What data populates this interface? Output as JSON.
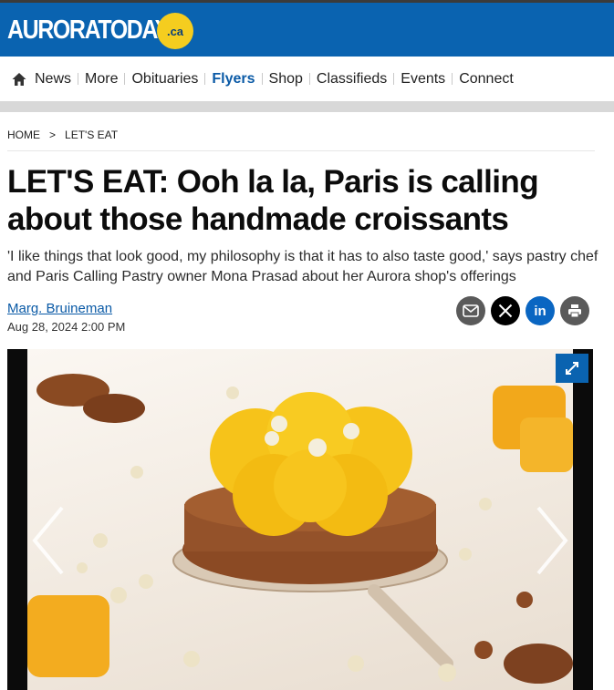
{
  "header": {
    "logo_text": "AURORATODAY",
    "logo_badge": ".ca",
    "brand_color": "#0a63b0",
    "badge_color": "#f5cd1f"
  },
  "nav": {
    "home_icon": "home-icon",
    "items": [
      {
        "label": "News",
        "active": false
      },
      {
        "label": "More",
        "active": false
      },
      {
        "label": "Obituaries",
        "active": false
      },
      {
        "label": "Flyers",
        "active": true
      },
      {
        "label": "Shop",
        "active": false
      },
      {
        "label": "Classifieds",
        "active": false
      },
      {
        "label": "Events",
        "active": false
      },
      {
        "label": "Connect",
        "active": false
      }
    ]
  },
  "breadcrumb": {
    "home": "HOME",
    "separator": ">",
    "section": "LET'S EAT"
  },
  "article": {
    "headline": "LET'S EAT: Ooh la la, Paris is calling about those handmade croissants",
    "subhead": "'I like things that look good, my philosophy is that it has to also taste good,' says pastry chef and Paris Calling Pastry owner Mona Prasad about her Aurora shop's offerings",
    "author": "Marg. Bruineman",
    "date": "Aug 28, 2024 2:00 PM"
  },
  "share": {
    "email_icon": "email-icon",
    "x_icon": "x-icon",
    "linkedin_label": "in",
    "print_icon": "print-icon"
  },
  "gallery": {
    "expand_icon": "expand-icon",
    "prev_icon": "chevron-left-icon",
    "next_icon": "chevron-right-icon"
  }
}
